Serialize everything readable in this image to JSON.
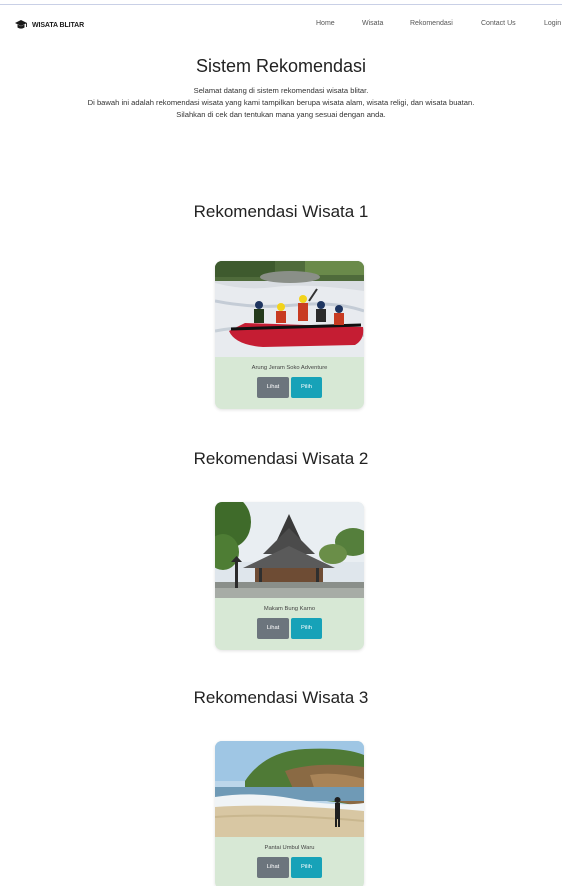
{
  "brand": {
    "name": "WISATA BLITAR",
    "icon": "graduation-cap-icon"
  },
  "nav": {
    "items": [
      {
        "label": "Home"
      },
      {
        "label": "Wisata"
      },
      {
        "label": "Rekomendasi"
      },
      {
        "label": "Contact Us"
      },
      {
        "label": "Login"
      }
    ]
  },
  "hero": {
    "title": "Sistem Rekomendasi",
    "lines": [
      "Selamat datang di sistem rekomendasi wisata blitar.",
      "Di bawah ini adalah rekomendasi wisata yang kami tampilkan berupa wisata alam, wisata religi, dan wisata buatan.",
      "Silahkan di cek dan tentukan mana yang sesuai dengan anda."
    ]
  },
  "recommendations": [
    {
      "heading": "Rekomendasi Wisata 1",
      "caption": "Arung Jeram Soko Adventure",
      "lihat_label": "Lihat",
      "pilih_label": "Pilih"
    },
    {
      "heading": "Rekomendasi Wisata 2",
      "caption": "Makam Bung Karno",
      "lihat_label": "Lihat",
      "pilih_label": "Pilih"
    },
    {
      "heading": "Rekomendasi Wisata 3",
      "caption": "Pantai Umbul Waru",
      "lihat_label": "Lihat",
      "pilih_label": "Pilih"
    }
  ],
  "colors": {
    "card_background": "#d7e8d5",
    "lihat_button": "#6c757d",
    "pilih_button": "#17a2b8"
  }
}
